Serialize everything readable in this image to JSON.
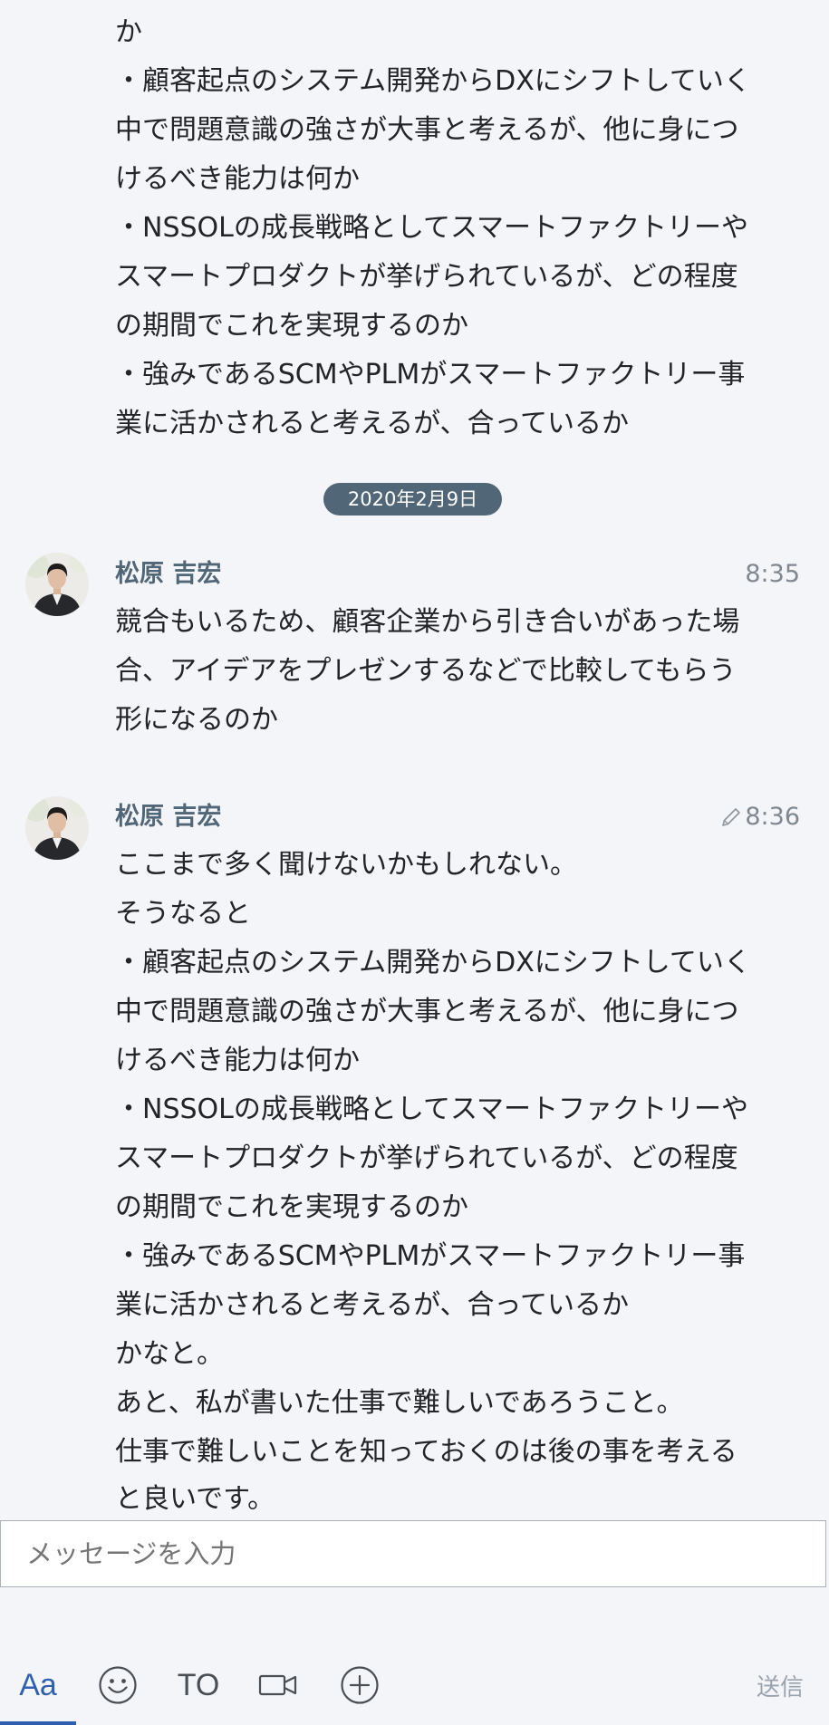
{
  "timeline": {
    "top_message": {
      "lines": [
        "か",
        "・顧客起点のシステム開発からDXにシフトしていく",
        "中で問題意識の強さが大事と考えるが、他に身につ",
        "けるべき能力は何か",
        "・NSSOLの成長戦略としてスマートファクトリーや",
        "スマートプロダクトが挙げられているが、どの程度",
        "の期間でこれを実現するのか",
        "・強みであるSCMやPLMがスマートファクトリー事",
        "業に活かされると考えるが、合っているか"
      ]
    },
    "date_separator": "2020年2月9日",
    "messages": [
      {
        "sender": "松原 吉宏",
        "time": "8:35",
        "edited": false,
        "lines": [
          "競合もいるため、顧客企業から引き合いがあった場",
          "合、アイデアをプレゼンするなどで比較してもらう",
          "形になるのか"
        ]
      },
      {
        "sender": "松原 吉宏",
        "time": "8:36",
        "edited": true,
        "lines": [
          "ここまで多く聞けないかもしれない。",
          "そうなると",
          "・顧客起点のシステム開発からDXにシフトしていく",
          "中で問題意識の強さが大事と考えるが、他に身につ",
          "けるべき能力は何か",
          "・NSSOLの成長戦略としてスマートファクトリーや",
          "スマートプロダクトが挙げられているが、どの程度",
          "の期間でこれを実現するのか",
          "・強みであるSCMやPLMがスマートファクトリー事",
          "業に活かされると考えるが、合っているか",
          "かなと。",
          "あと、私が書いた仕事で難しいであろうこと。",
          "仕事で難しいことを知っておくのは後の事を考える",
          "と良いです。"
        ]
      }
    ]
  },
  "composer": {
    "placeholder": "メッセージを入力",
    "toolbar": {
      "format_label": "Aa",
      "emoji_icon": "smiley-icon",
      "to_label": "TO",
      "video_icon": "video-camera-icon",
      "add_icon": "plus-circle-icon",
      "send_label": "送信"
    }
  },
  "colors": {
    "background": "#f4f5f8",
    "date_pill": "#516677",
    "sender_name": "#516677",
    "accent": "#2f5fae"
  }
}
